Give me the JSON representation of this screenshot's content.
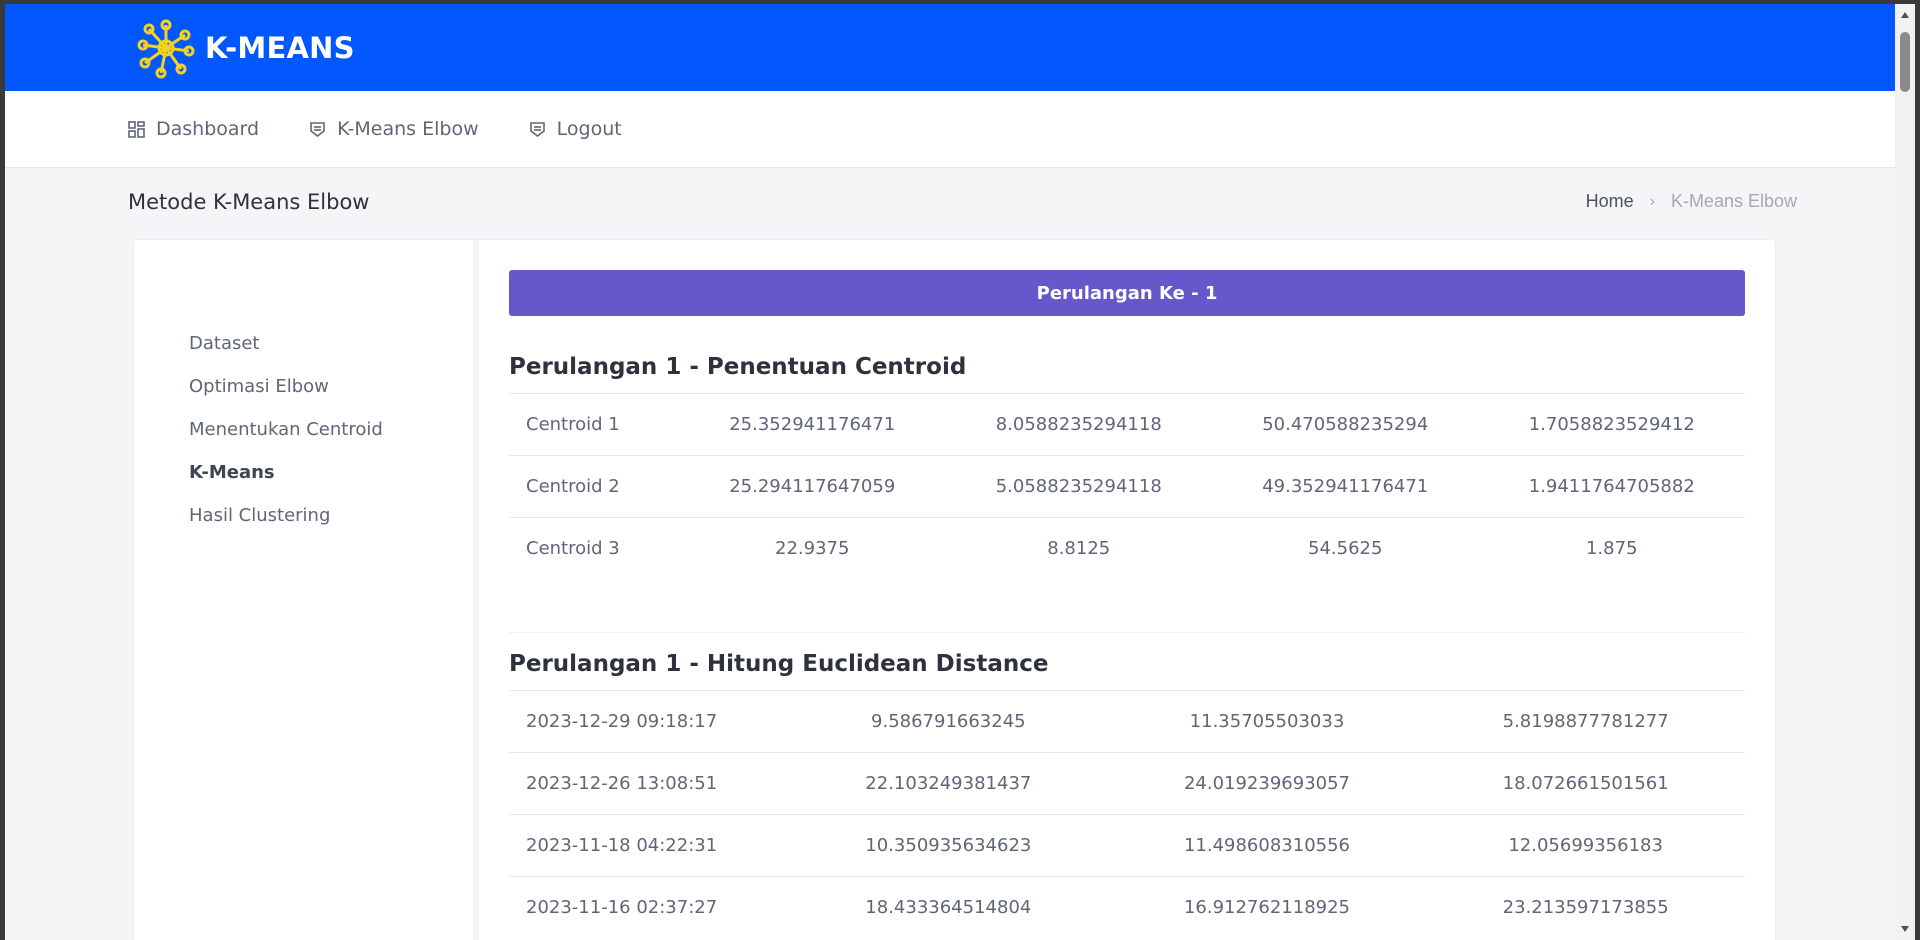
{
  "header": {
    "brand": "K-MEANS"
  },
  "nav": {
    "items": [
      {
        "label": "Dashboard"
      },
      {
        "label": "K-Means Elbow"
      },
      {
        "label": "Logout"
      }
    ]
  },
  "page": {
    "title": "Metode K-Means Elbow",
    "breadcrumb": {
      "home": "Home",
      "separator": "›",
      "current": "K-Means Elbow"
    }
  },
  "sidebar": {
    "items": [
      {
        "label": "Dataset"
      },
      {
        "label": "Optimasi Elbow"
      },
      {
        "label": "Menentukan Centroid"
      },
      {
        "label": "K-Means",
        "active": true
      },
      {
        "label": "Hasil Clustering"
      }
    ]
  },
  "main": {
    "banner": "Perulangan Ke - 1",
    "centroid_section": {
      "title": "Perulangan 1 - Penentuan Centroid",
      "rows": [
        {
          "label": "Centroid 1",
          "values": [
            "25.352941176471",
            "8.0588235294118",
            "50.470588235294",
            "1.7058823529412"
          ]
        },
        {
          "label": "Centroid 2",
          "values": [
            "25.294117647059",
            "5.0588235294118",
            "49.352941176471",
            "1.9411764705882"
          ]
        },
        {
          "label": "Centroid 3",
          "values": [
            "22.9375",
            "8.8125",
            "54.5625",
            "1.875"
          ]
        }
      ]
    },
    "distance_section": {
      "title": "Perulangan 1 - Hitung Euclidean Distance",
      "rows": [
        {
          "label": "2023-12-29 09:18:17",
          "values": [
            "9.586791663245",
            "11.35705503033",
            "5.8198877781277"
          ]
        },
        {
          "label": "2023-12-26 13:08:51",
          "values": [
            "22.103249381437",
            "24.019239693057",
            "18.072661501561"
          ]
        },
        {
          "label": "2023-11-18 04:22:31",
          "values": [
            "10.350935634623",
            "11.498608310556",
            "12.05699356183"
          ]
        },
        {
          "label": "2023-11-16 02:37:27",
          "values": [
            "18.433364514804",
            "16.912762118925",
            "23.213597173855"
          ]
        }
      ]
    }
  },
  "colors": {
    "topbar": "#0357fe",
    "banner": "#6458cb",
    "logo": "#f5d31c"
  }
}
